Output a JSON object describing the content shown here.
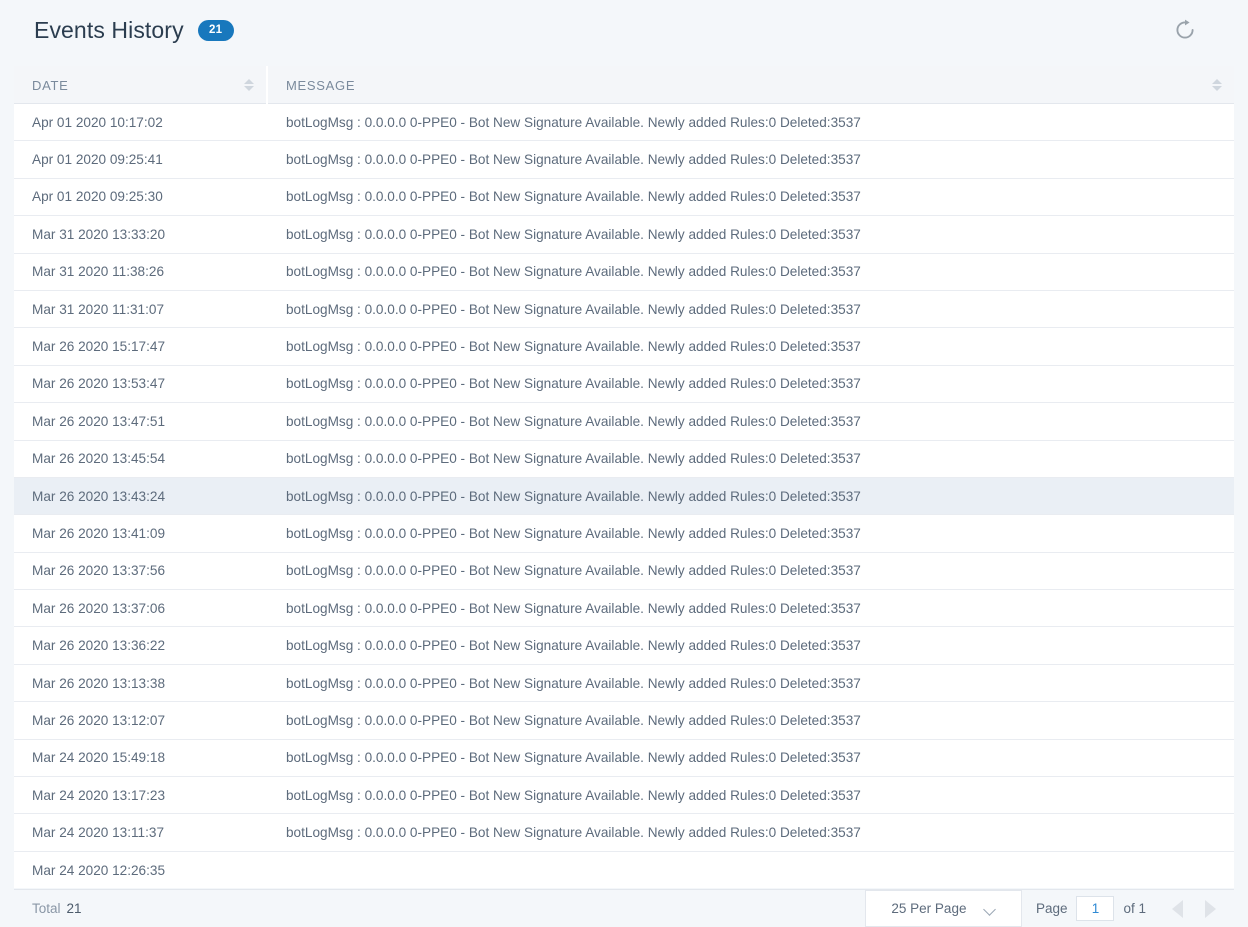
{
  "header": {
    "title": "Events History",
    "badge_count": "21",
    "refresh_icon": "refresh-icon",
    "accent_color": "#1878bd"
  },
  "table": {
    "columns": [
      {
        "key": "date",
        "label": "DATE",
        "sort_icon": "sort-updown-icon"
      },
      {
        "key": "message",
        "label": "MESSAGE",
        "sort_icon": "sort-updown-icon"
      }
    ],
    "selected_row_index": 10,
    "rows": [
      {
        "date": "Apr 01 2020 10:17:02",
        "message": "botLogMsg : 0.0.0.0 0-PPE0 -  Bot New Signature Available. Newly added Rules:0 Deleted:3537"
      },
      {
        "date": "Apr 01 2020 09:25:41",
        "message": "botLogMsg : 0.0.0.0 0-PPE0 -  Bot New Signature Available. Newly added Rules:0 Deleted:3537"
      },
      {
        "date": "Apr 01 2020 09:25:30",
        "message": "botLogMsg : 0.0.0.0 0-PPE0 -  Bot New Signature Available. Newly added Rules:0 Deleted:3537"
      },
      {
        "date": "Mar 31 2020 13:33:20",
        "message": "botLogMsg : 0.0.0.0 0-PPE0 -  Bot New Signature Available. Newly added Rules:0 Deleted:3537"
      },
      {
        "date": "Mar 31 2020 11:38:26",
        "message": "botLogMsg : 0.0.0.0 0-PPE0 -  Bot New Signature Available. Newly added Rules:0 Deleted:3537"
      },
      {
        "date": "Mar 31 2020 11:31:07",
        "message": "botLogMsg : 0.0.0.0 0-PPE0 -  Bot New Signature Available. Newly added Rules:0 Deleted:3537"
      },
      {
        "date": "Mar 26 2020 15:17:47",
        "message": "botLogMsg : 0.0.0.0 0-PPE0 -  Bot New Signature Available. Newly added Rules:0 Deleted:3537"
      },
      {
        "date": "Mar 26 2020 13:53:47",
        "message": "botLogMsg : 0.0.0.0 0-PPE0 -  Bot New Signature Available. Newly added Rules:0 Deleted:3537"
      },
      {
        "date": "Mar 26 2020 13:47:51",
        "message": "botLogMsg : 0.0.0.0 0-PPE0 -  Bot New Signature Available. Newly added Rules:0 Deleted:3537"
      },
      {
        "date": "Mar 26 2020 13:45:54",
        "message": "botLogMsg : 0.0.0.0 0-PPE0 -  Bot New Signature Available. Newly added Rules:0 Deleted:3537"
      },
      {
        "date": "Mar 26 2020 13:43:24",
        "message": "botLogMsg : 0.0.0.0 0-PPE0 -  Bot New Signature Available. Newly added Rules:0 Deleted:3537"
      },
      {
        "date": "Mar 26 2020 13:41:09",
        "message": "botLogMsg : 0.0.0.0 0-PPE0 -  Bot New Signature Available. Newly added Rules:0 Deleted:3537"
      },
      {
        "date": "Mar 26 2020 13:37:56",
        "message": "botLogMsg : 0.0.0.0 0-PPE0 -  Bot New Signature Available. Newly added Rules:0 Deleted:3537"
      },
      {
        "date": "Mar 26 2020 13:37:06",
        "message": "botLogMsg : 0.0.0.0 0-PPE0 -  Bot New Signature Available. Newly added Rules:0 Deleted:3537"
      },
      {
        "date": "Mar 26 2020 13:36:22",
        "message": "botLogMsg : 0.0.0.0 0-PPE0 -  Bot New Signature Available. Newly added Rules:0 Deleted:3537"
      },
      {
        "date": "Mar 26 2020 13:13:38",
        "message": "botLogMsg : 0.0.0.0 0-PPE0 -  Bot New Signature Available. Newly added Rules:0 Deleted:3537"
      },
      {
        "date": "Mar 26 2020 13:12:07",
        "message": "botLogMsg : 0.0.0.0 0-PPE0 -  Bot New Signature Available. Newly added Rules:0 Deleted:3537"
      },
      {
        "date": "Mar 24 2020 15:49:18",
        "message": "botLogMsg : 0.0.0.0 0-PPE0 -  Bot New Signature Available. Newly added Rules:0 Deleted:3537"
      },
      {
        "date": "Mar 24 2020 13:17:23",
        "message": "botLogMsg : 0.0.0.0 0-PPE0 -  Bot New Signature Available. Newly added Rules:0 Deleted:3537"
      },
      {
        "date": "Mar 24 2020 13:11:37",
        "message": "botLogMsg : 0.0.0.0 0-PPE0 -  Bot New Signature Available. Newly added Rules:0 Deleted:3537"
      },
      {
        "date": "Mar 24 2020 12:26:35",
        "message": ""
      }
    ]
  },
  "footer": {
    "total_label": "Total",
    "total_value": "21",
    "per_page_value": "25 Per Page",
    "per_page_chevron": "chevron-down-icon",
    "page_label": "Page",
    "page_value": "1",
    "page_of": "of 1",
    "prev_icon": "triangle-left-icon",
    "next_icon": "triangle-right-icon"
  }
}
